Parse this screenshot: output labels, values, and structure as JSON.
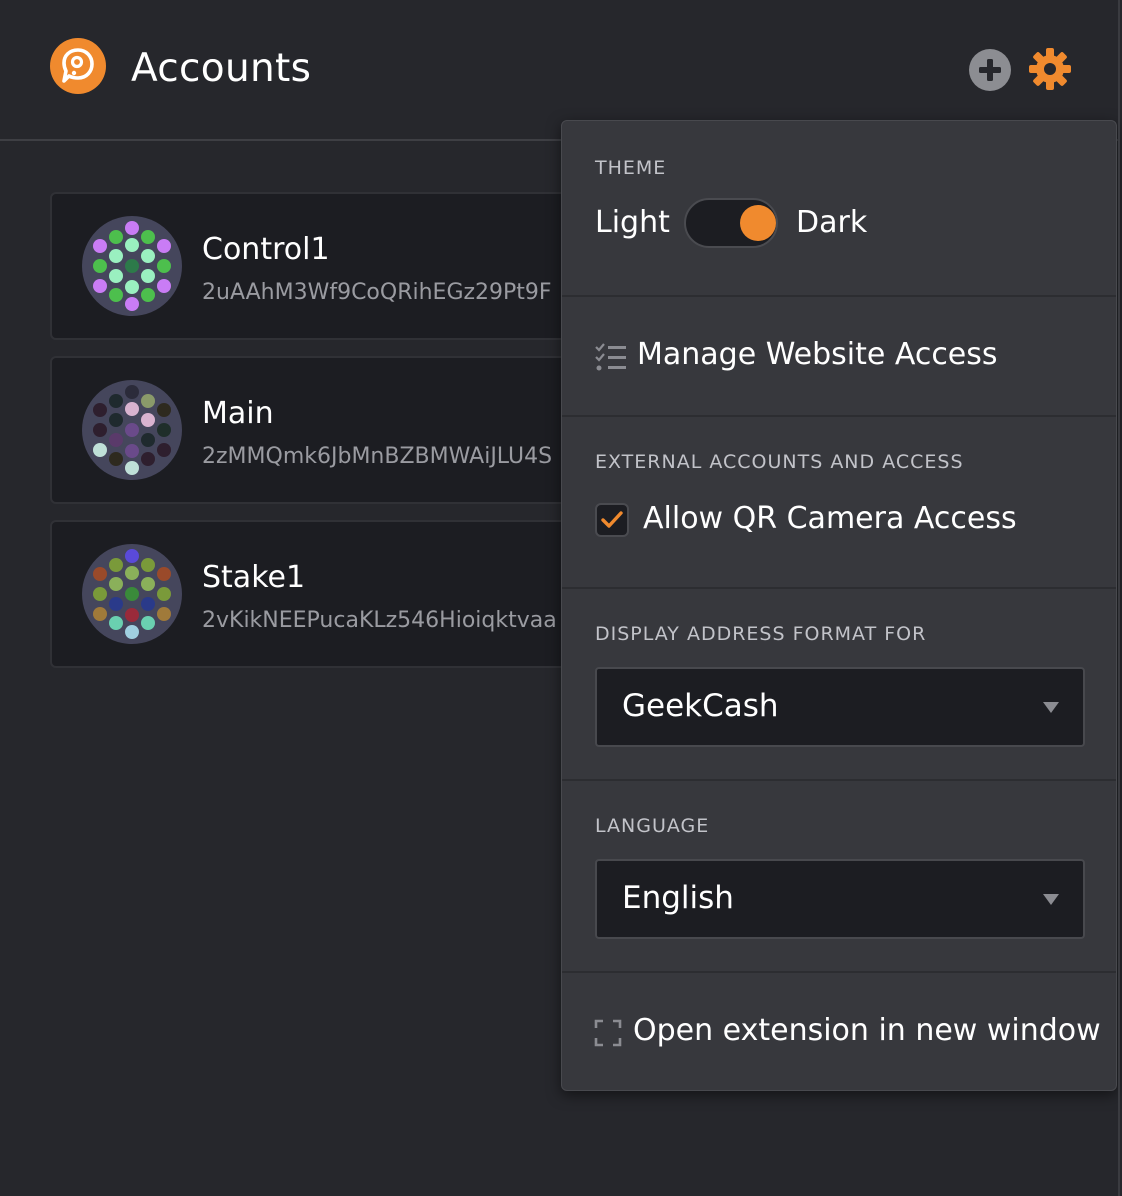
{
  "header": {
    "title": "Accounts",
    "add_icon": "plus-circle-icon",
    "settings_icon": "gear-icon",
    "logo_icon": "polkadot-logo-icon"
  },
  "accounts": [
    {
      "name": "Control1",
      "address": "2uAAhM3Wf9CoQRihEGz29Pt9F"
    },
    {
      "name": "Main",
      "address": "2zMMQmk6JbMnBZBMWAiJLU4S"
    },
    {
      "name": "Stake1",
      "address": "2vKikNEEPucaKLz546Hioiqktvaa"
    }
  ],
  "settings_menu": {
    "theme": {
      "label": "THEME",
      "light": "Light",
      "dark": "Dark",
      "selected": "Dark"
    },
    "manage_access": {
      "label": "Manage Website Access",
      "icon": "checklist-icon"
    },
    "external": {
      "label": "EXTERNAL ACCOUNTS AND ACCESS",
      "qr_label": "Allow QR Camera Access",
      "qr_checked": true
    },
    "address_format": {
      "label": "DISPLAY ADDRESS FORMAT FOR",
      "value": "GeekCash"
    },
    "language": {
      "label": "LANGUAGE",
      "value": "English"
    },
    "open_window": {
      "label": "Open extension in new window",
      "icon": "expand-icon"
    }
  },
  "colors": {
    "accent": "#f08a2e",
    "background": "#26272c",
    "card": "#1c1d22",
    "menu": "#37383d"
  }
}
